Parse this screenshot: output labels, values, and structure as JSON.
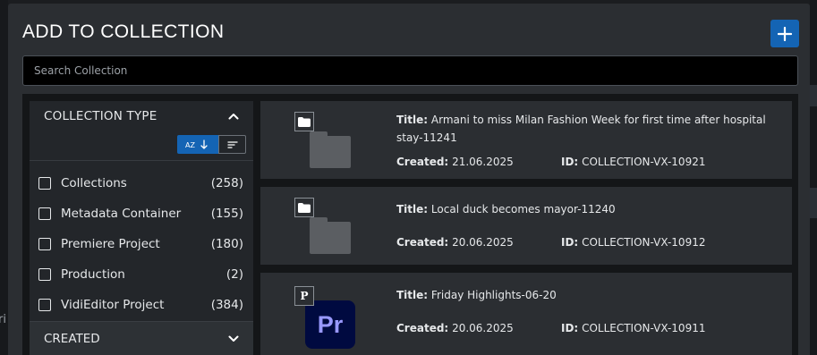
{
  "dialog": {
    "title": "ADD TO COLLECTION",
    "add_button_icon": "plus-icon",
    "search": {
      "placeholder": "Search Collection",
      "value": ""
    }
  },
  "backdrop": {
    "left_hint": "ri"
  },
  "filters": {
    "collection_type": {
      "label": "COLLECTION TYPE",
      "expanded": true,
      "sort_options": [
        {
          "icon": "sort-alpha-icon",
          "label": "AZ",
          "active": true
        },
        {
          "icon": "sort-lines-icon",
          "label": "",
          "active": false
        }
      ],
      "options": [
        {
          "name": "Collections",
          "count": "(258)",
          "checked": false
        },
        {
          "name": "Metadata Container",
          "count": "(155)",
          "checked": false
        },
        {
          "name": "Premiere Project",
          "count": "(180)",
          "checked": false
        },
        {
          "name": "Production",
          "count": "(2)",
          "checked": false
        },
        {
          "name": "VidiEditor Project",
          "count": "(384)",
          "checked": false
        }
      ]
    },
    "created": {
      "label": "CREATED",
      "expanded": false
    }
  },
  "results": [
    {
      "type_icon": "folder-icon",
      "title_key": "Title:",
      "title": "Armani to miss Milan Fashion Week for first time after hospital stay-11241",
      "created_key": "Created:",
      "created": "21.06.2025",
      "id_key": "ID:",
      "id": "COLLECTION-VX-10921"
    },
    {
      "type_icon": "folder-icon",
      "title_key": "Title:",
      "title": "Local duck becomes mayor-11240",
      "created_key": "Created:",
      "created": "20.06.2025",
      "id_key": "ID:",
      "id": "COLLECTION-VX-10912"
    },
    {
      "type_icon": "premiere-project-icon",
      "badge_letter": "P",
      "logo_text": "Pr",
      "title_key": "Title:",
      "title": "Friday Highlights-06-20",
      "created_key": "Created:",
      "created": "20.06.2025",
      "id_key": "ID:",
      "id": "COLLECTION-VX-10911"
    }
  ],
  "colors": {
    "accent": "#1464b4",
    "dialog_bg": "#2b2e32",
    "panel_bg": "#23262a",
    "content_bg": "#141618",
    "premiere_bg": "#000a40",
    "premiere_fg": "#9999ff"
  }
}
